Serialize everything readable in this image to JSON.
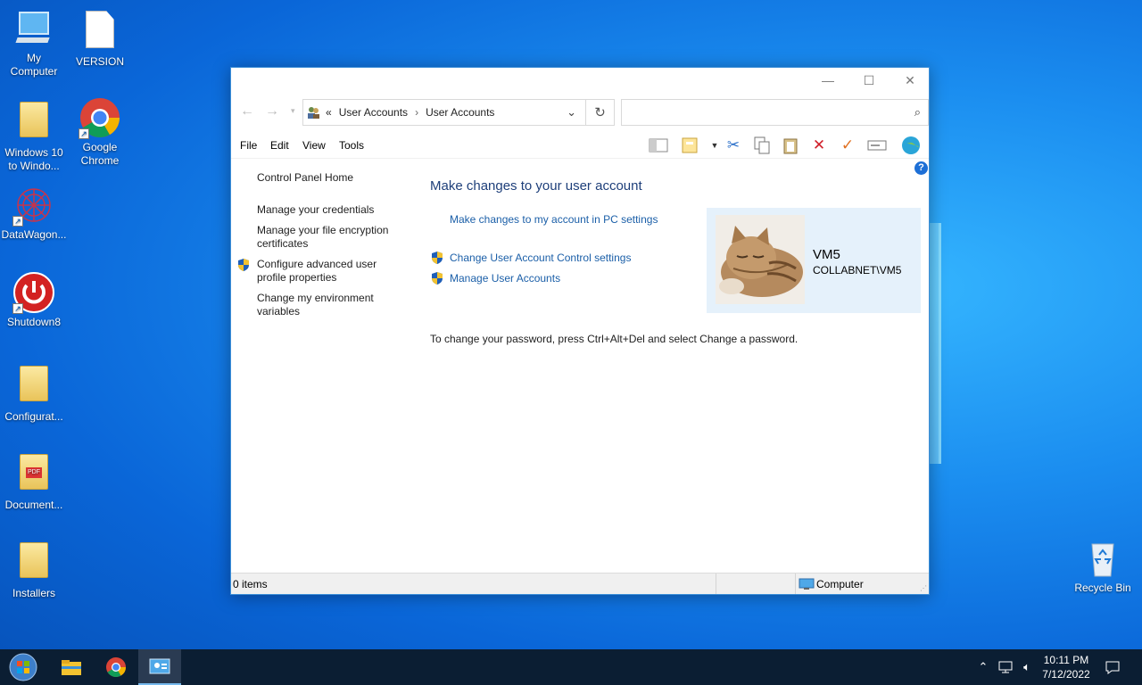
{
  "desktop": {
    "icons": [
      {
        "label": "My\nComputer"
      },
      {
        "label": "VERSION"
      },
      {
        "label": "Windows 10\nto Windo..."
      },
      {
        "label": "Google\nChrome"
      },
      {
        "label": "DataWagon..."
      },
      {
        "label": "Shutdown8"
      },
      {
        "label": "Configurat..."
      },
      {
        "label": "Document..."
      },
      {
        "label": "Installers"
      },
      {
        "label": "Recycle Bin"
      }
    ]
  },
  "window": {
    "breadcrumb": {
      "chevrons": "«",
      "item1": "User Accounts",
      "separator": "›",
      "item2": "User Accounts"
    },
    "search_placeholder": "",
    "menu": {
      "file": "File",
      "edit": "Edit",
      "view": "View",
      "tools": "Tools"
    },
    "sidebar": {
      "home": "Control Panel Home",
      "credentials": "Manage your credentials",
      "encryption": "Manage your file encryption certificates",
      "advanced": "Configure advanced user profile properties",
      "environment": "Change my environment variables"
    },
    "main": {
      "heading": "Make changes to your user account",
      "pc_settings_link": "Make changes to my account in PC settings",
      "uac_link": "Change User Account Control settings",
      "manage_link": "Manage User Accounts",
      "password_note": "To change your password, press Ctrl+Alt+Del and select Change a password."
    },
    "account": {
      "name": "VM5",
      "domain_user": "COLLABNET\\VM5"
    },
    "status": {
      "items": "0 items",
      "location": "Computer"
    }
  },
  "taskbar": {
    "time": "10:11 PM",
    "date": "7/12/2022"
  },
  "colors": {
    "accent": "#0078d7",
    "link": "#1b5fa8",
    "heading": "#1e3f7a",
    "card": "#e5f1fb"
  }
}
